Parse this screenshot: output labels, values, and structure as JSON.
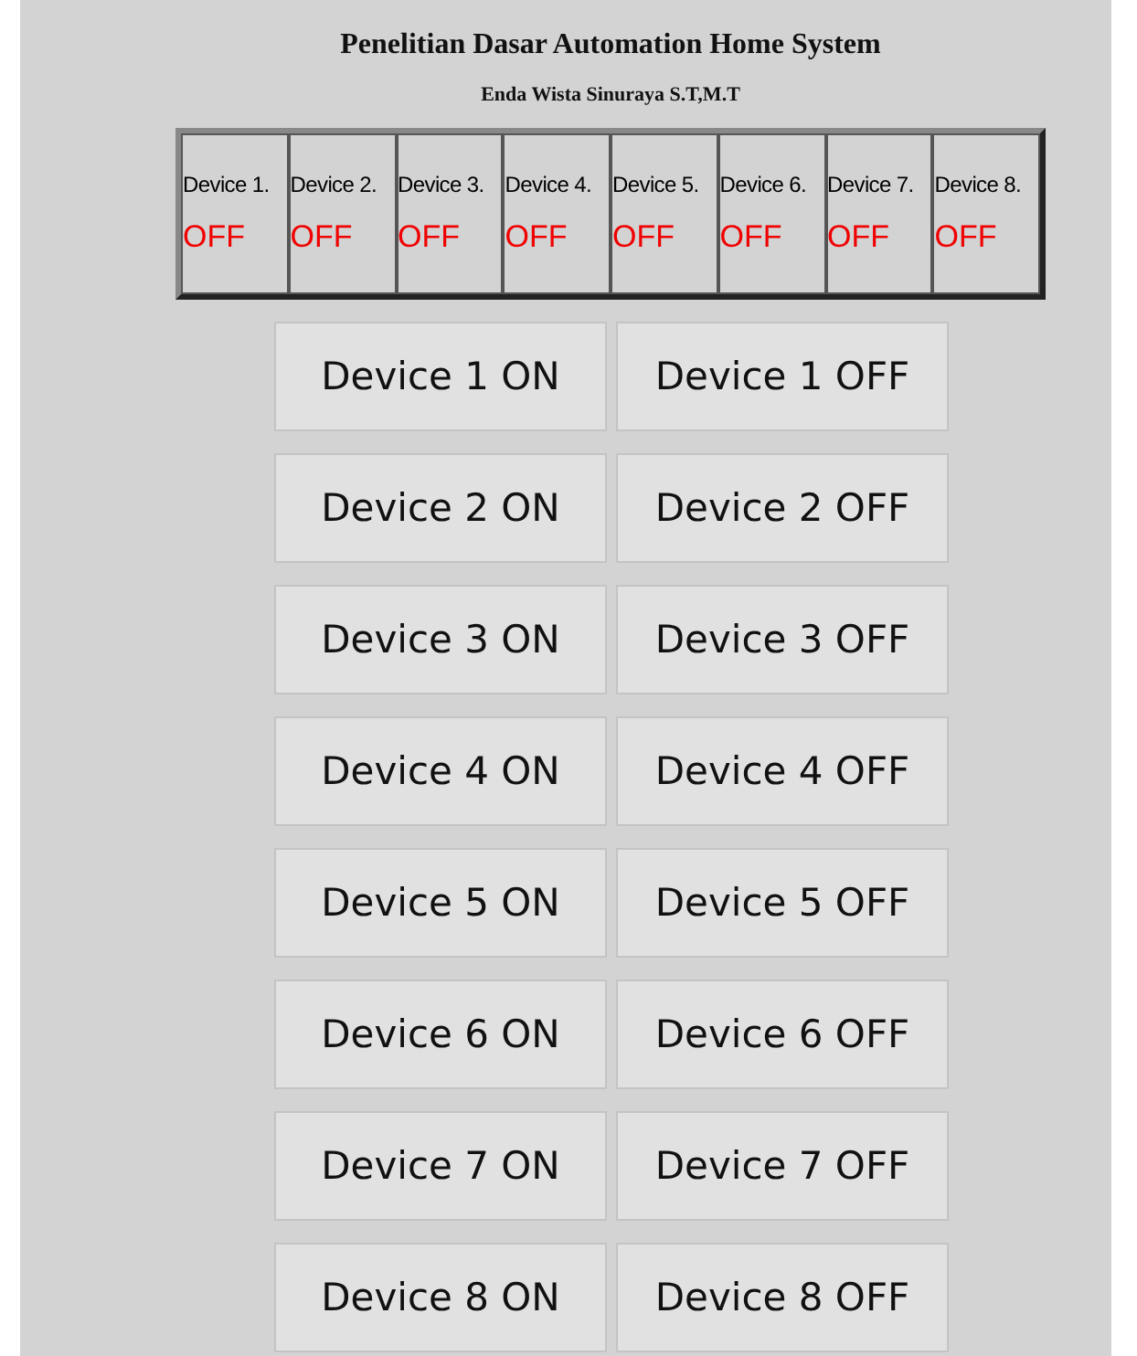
{
  "title": "Penelitian Dasar Automation Home System",
  "subtitle": "Enda Wista Sinuraya S.T,M.T",
  "status_table": [
    {
      "label": "Device 1.",
      "status": "OFF",
      "on": false
    },
    {
      "label": "Device 2.",
      "status": "OFF",
      "on": false
    },
    {
      "label": "Device 3.",
      "status": "OFF",
      "on": false
    },
    {
      "label": "Device 4.",
      "status": "OFF",
      "on": false
    },
    {
      "label": "Device 5.",
      "status": "OFF",
      "on": false
    },
    {
      "label": "Device 6.",
      "status": "OFF",
      "on": false
    },
    {
      "label": "Device 7.",
      "status": "OFF",
      "on": false
    },
    {
      "label": "Device 8.",
      "status": "OFF",
      "on": false
    }
  ],
  "buttons": [
    {
      "on": "Device 1 ON",
      "off": "Device 1 OFF"
    },
    {
      "on": "Device 2 ON",
      "off": "Device 2 OFF"
    },
    {
      "on": "Device 3 ON",
      "off": "Device 3 OFF"
    },
    {
      "on": "Device 4 ON",
      "off": "Device 4 OFF"
    },
    {
      "on": "Device 5 ON",
      "off": "Device 5 OFF"
    },
    {
      "on": "Device 6 ON",
      "off": "Device 6 OFF"
    },
    {
      "on": "Device 7 ON",
      "off": "Device 7 OFF"
    },
    {
      "on": "Device 8 ON",
      "off": "Device 8 OFF"
    }
  ]
}
